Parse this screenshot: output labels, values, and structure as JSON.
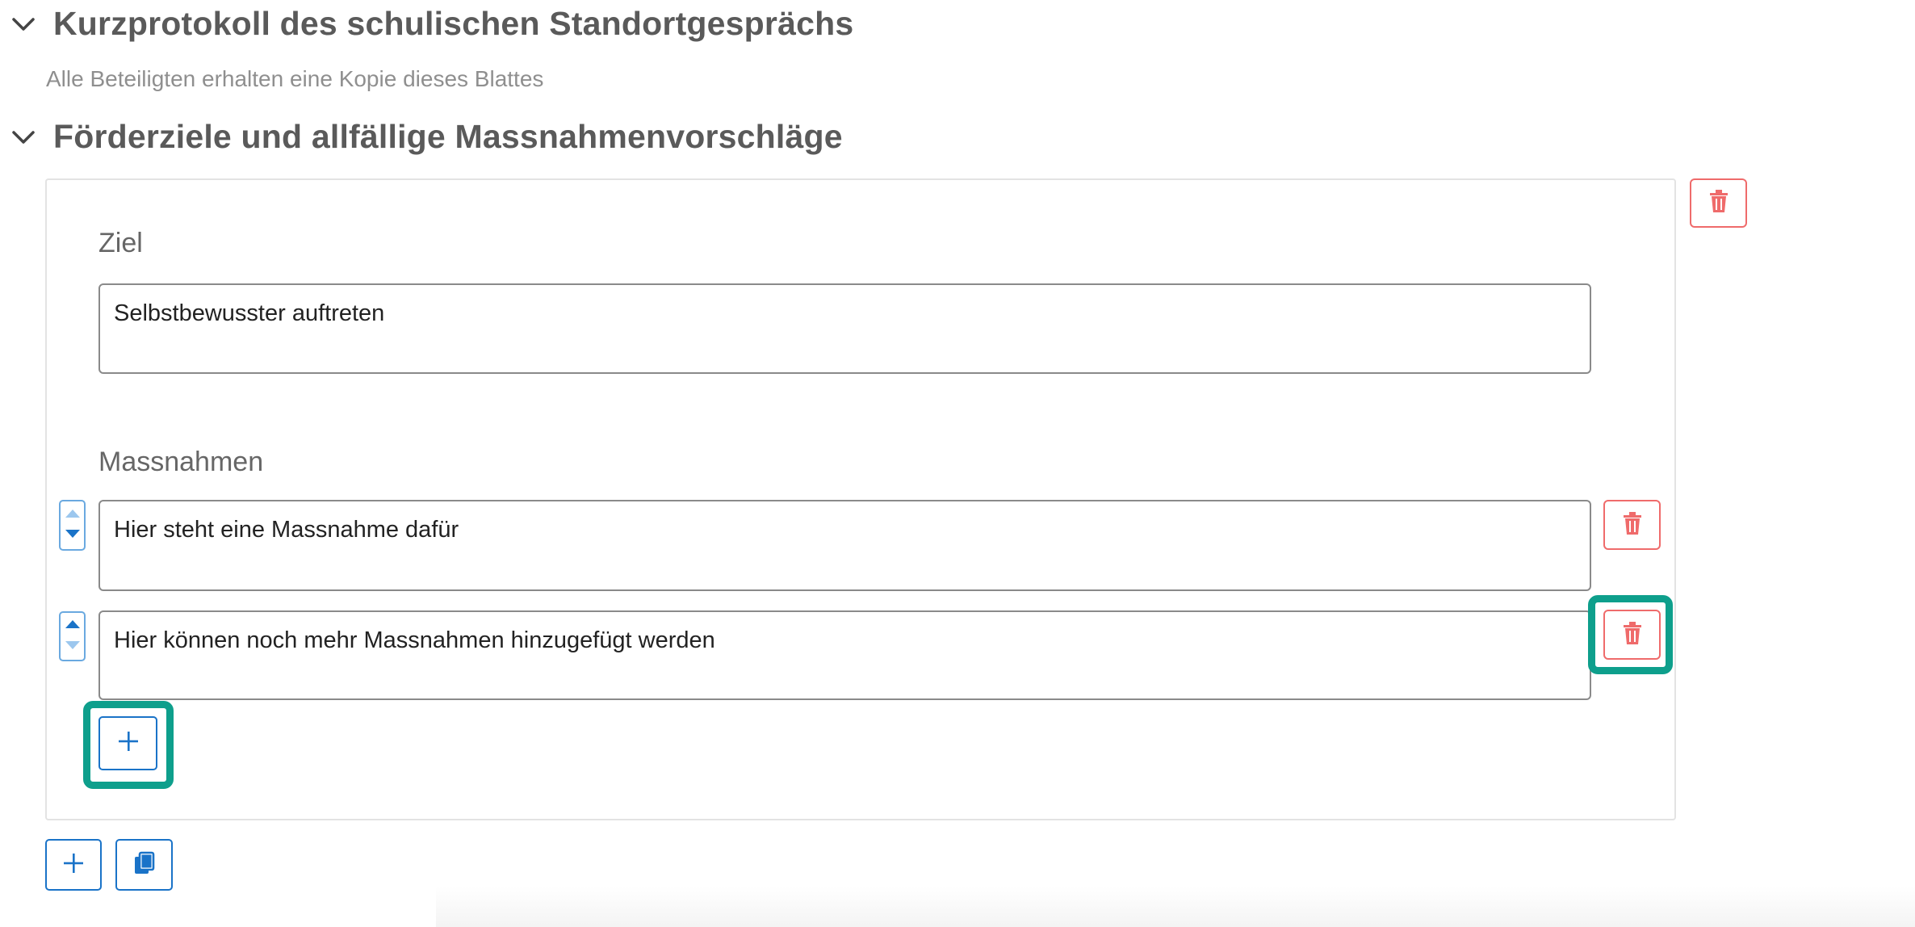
{
  "sections": {
    "protocol": {
      "title": "Kurzprotokoll des schulischen Standortgesprächs",
      "subtitle": "Alle Beteiligten erhalten eine Kopie dieses Blattes"
    },
    "goals": {
      "title": "Förderziele und allfällige Massnahmenvorschläge",
      "goal_label": "Ziel",
      "goal_value": "Selbstbewusster auftreten",
      "measures_label": "Massnahmen",
      "measures": [
        {
          "value": "Hier steht eine Massnahme dafür"
        },
        {
          "value": "Hier können noch mehr Massnahmen hinzugefügt werden"
        }
      ]
    }
  },
  "icons": {
    "chevron": "chevron-down-icon",
    "delete": "trash-icon",
    "add": "plus-icon",
    "duplicate": "copy-icon",
    "move_up": "caret-up-icon",
    "move_down": "caret-down-icon"
  },
  "colors": {
    "delete_red": "#ef6b6b",
    "action_blue": "#1a73c8",
    "highlight_teal": "#0e9f8c",
    "heading_grey": "#5a5a5a"
  }
}
